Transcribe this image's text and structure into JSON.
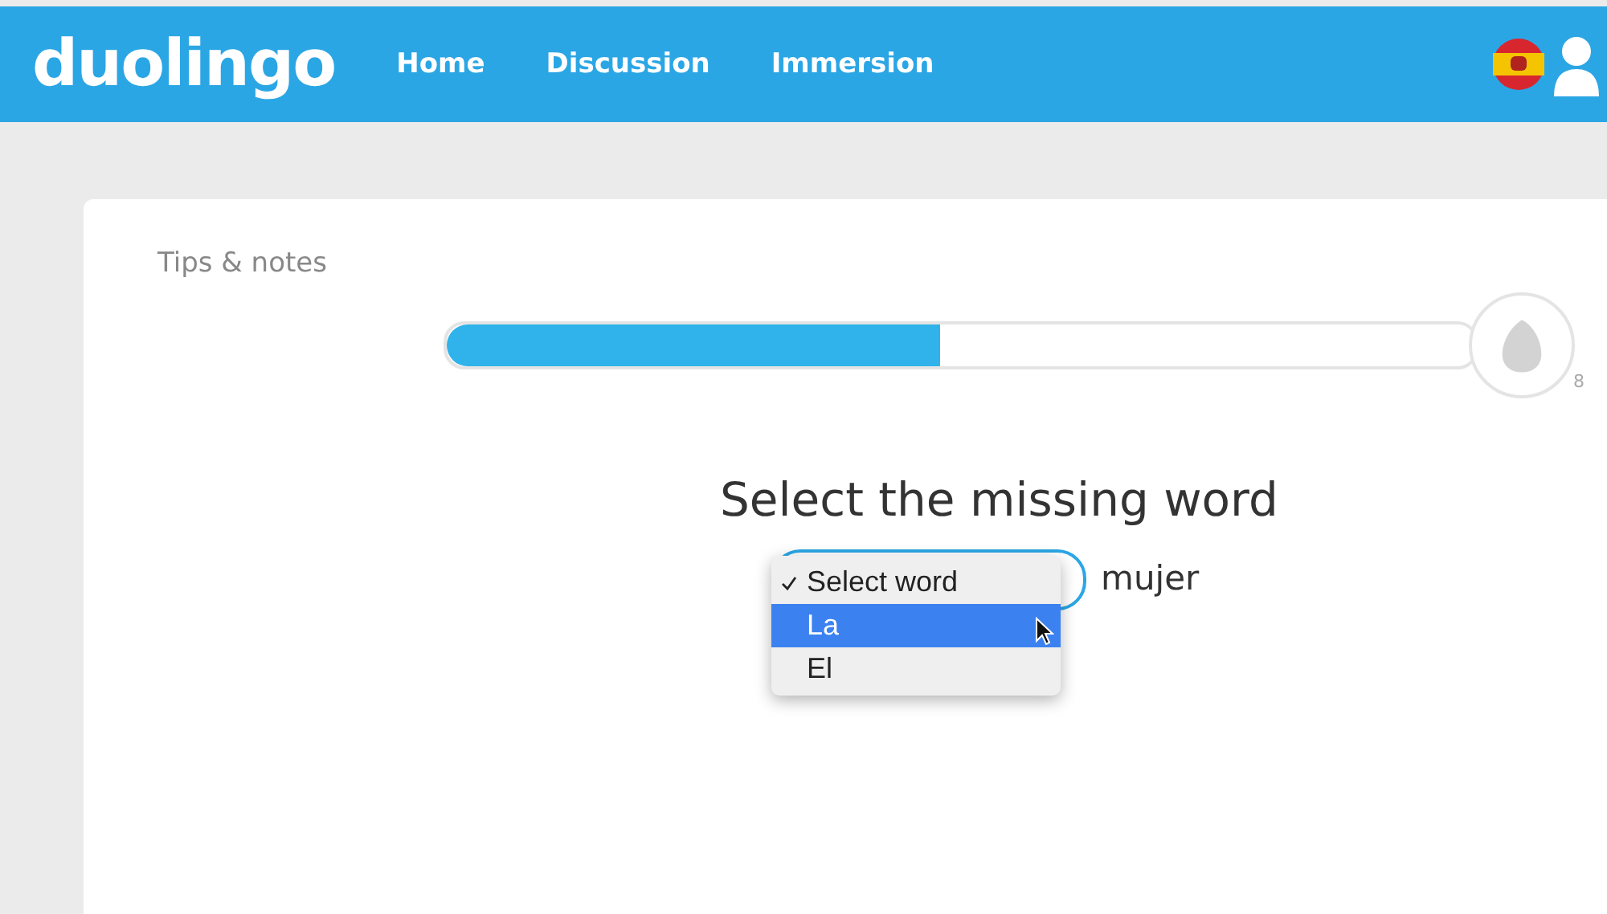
{
  "header": {
    "logo": "duolingo",
    "nav": [
      {
        "label": "Home"
      },
      {
        "label": "Discussion"
      },
      {
        "label": "Immersion"
      }
    ]
  },
  "tips_link": "Tips & notes",
  "progress": {
    "level": 0.48,
    "count": "8"
  },
  "question": "Select the missing word",
  "dropdown": {
    "options": [
      {
        "label": "Select word",
        "checked": true,
        "selected": false
      },
      {
        "label": "La",
        "checked": false,
        "selected": true
      },
      {
        "label": "El",
        "checked": false,
        "selected": false
      }
    ]
  },
  "following_word": "mujer"
}
